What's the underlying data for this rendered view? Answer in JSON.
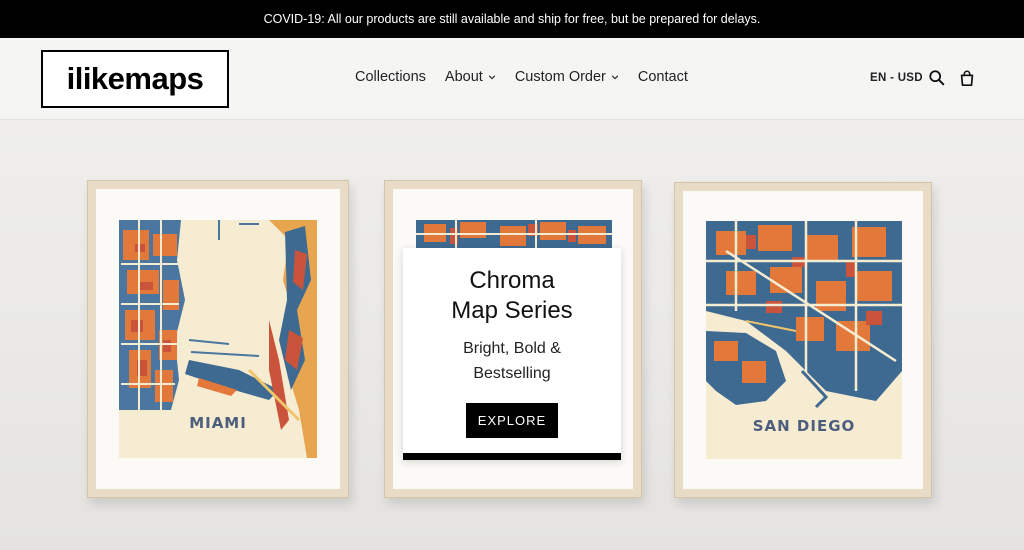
{
  "announcement": {
    "text": "COVID-19: All our products are still available and ship for free, but be prepared for delays."
  },
  "header": {
    "logo": "ilikemaps",
    "nav": [
      {
        "label": "Collections",
        "has_dropdown": false
      },
      {
        "label": "About",
        "has_dropdown": true
      },
      {
        "label": "Custom Order",
        "has_dropdown": true
      },
      {
        "label": "Contact",
        "has_dropdown": false
      }
    ],
    "locale": "EN - USD",
    "icons": [
      "search-icon",
      "cart-icon"
    ]
  },
  "hero": {
    "frames": [
      {
        "city": "MIAMI"
      },
      {
        "city": ""
      },
      {
        "city": "SAN DIEGO"
      }
    ],
    "card": {
      "title_line1": "Chroma",
      "title_line2": "Map Series",
      "subtitle_line1": "Bright, Bold &",
      "subtitle_line2": "Bestselling",
      "button_label": "EXPLORE"
    }
  },
  "colors": {
    "map_blue": "#3e6a92",
    "map_orange": "#e2783a",
    "map_red": "#c9543b",
    "map_cream": "#f6ecd2",
    "map_yellow": "#efc46a",
    "label": "#4d5e7c"
  }
}
